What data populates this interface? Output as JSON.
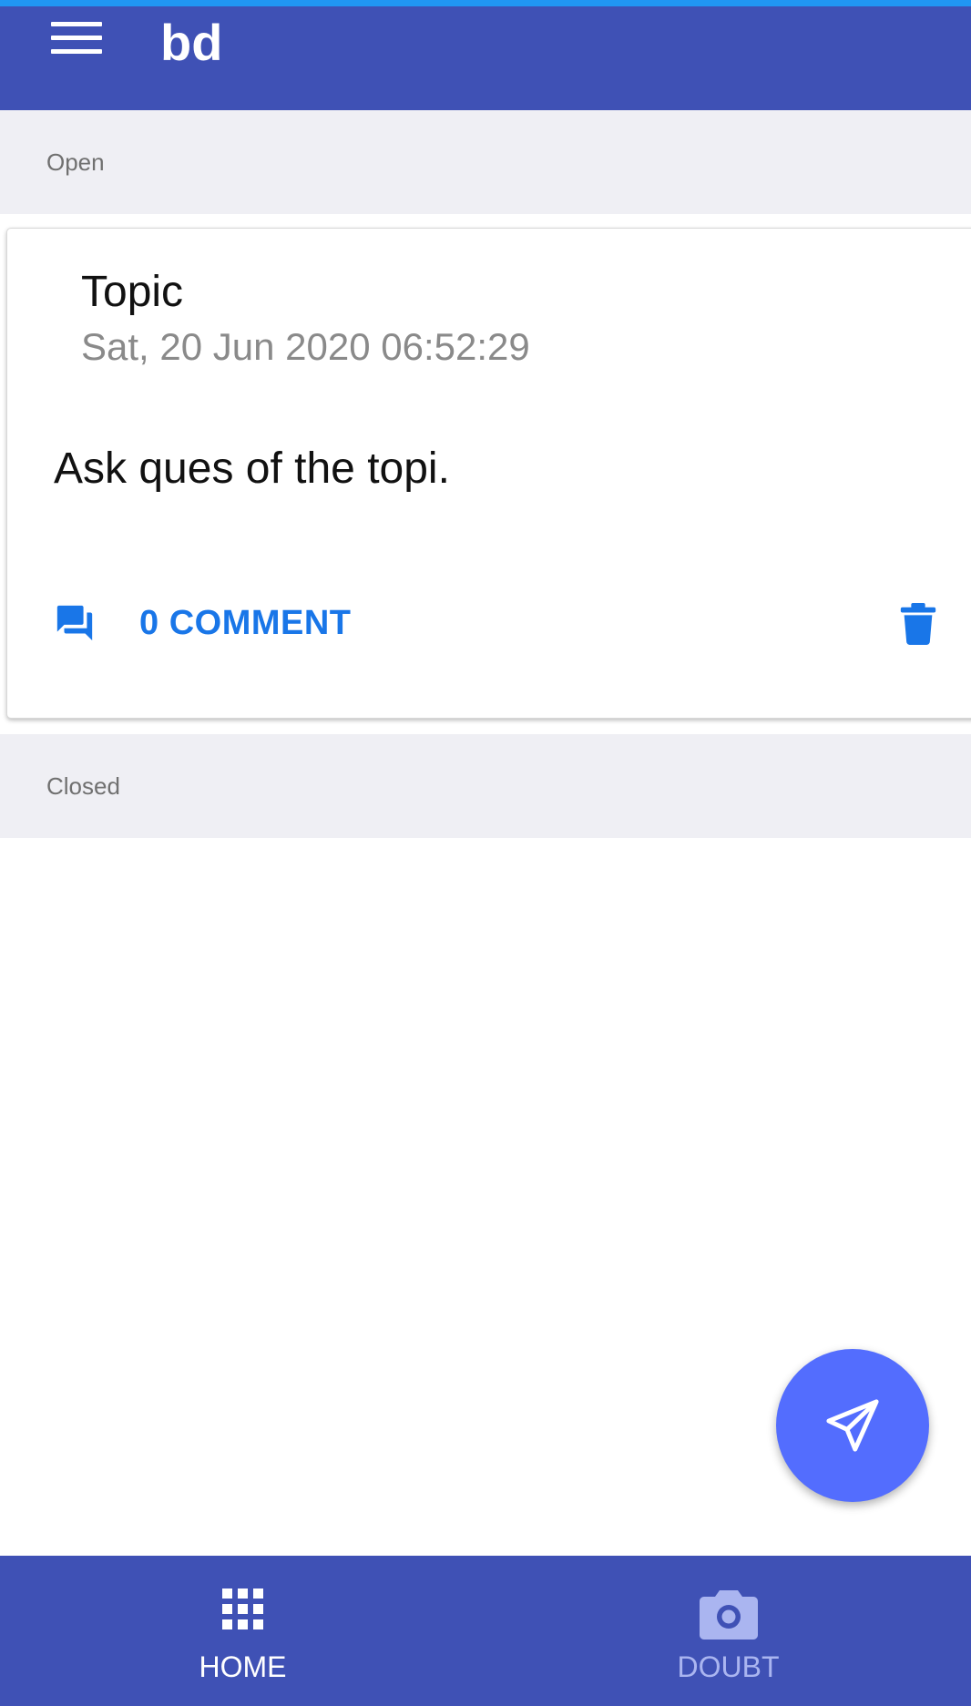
{
  "header": {
    "title": "bd",
    "menu_icon": "menu-icon"
  },
  "sections": {
    "open_label": "Open",
    "closed_label": "Closed"
  },
  "card": {
    "title": "Topic",
    "date": "Sat, 20 Jun 2020 06:52:29",
    "body": "Ask ques of the topi.",
    "comment_label": "0 COMMENT",
    "comment_icon": "forum-icon",
    "delete_icon": "trash-icon"
  },
  "fab": {
    "icon": "send-icon"
  },
  "bottom_nav": {
    "items": [
      {
        "label": "HOME",
        "icon": "apps-grid-icon",
        "active": true
      },
      {
        "label": "DOUBT",
        "icon": "camera-icon",
        "active": false
      }
    ]
  },
  "colors": {
    "primary": "#3f51b5",
    "accent_bar": "#2196f3",
    "link_blue": "#1976e8",
    "fab": "#536dfe",
    "section_bg": "#efeff4"
  }
}
